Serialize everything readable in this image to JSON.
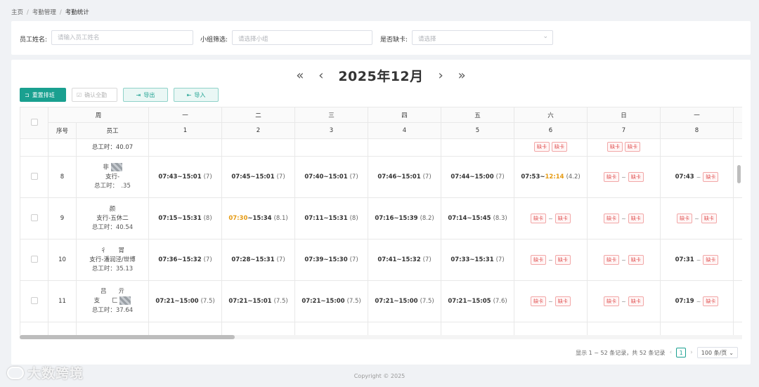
{
  "breadcrumb": [
    "主页",
    "考勤管理",
    "考勤统计"
  ],
  "filters": {
    "name_label": "员工姓名:",
    "name_placeholder": "请输入员工姓名",
    "group_label": "小组筛选:",
    "group_placeholder": "请选择小组",
    "missing_label": "是否缺卡:",
    "missing_placeholder": "请选择"
  },
  "month_nav": {
    "prev_year": "«",
    "prev_month": "‹",
    "title": "2025年12月",
    "next_month": "›",
    "next_year": "»"
  },
  "toolbar": {
    "reset_label": "重置排班",
    "confirm_label": "确认全勤",
    "export_label": "导出",
    "import_label": "导入"
  },
  "table": {
    "header_week_label": "周",
    "header_index_label": "序号",
    "header_employee_label": "员工",
    "weekdays": [
      "一",
      "二",
      "三",
      "四",
      "五",
      "六",
      "日",
      "一"
    ],
    "dates": [
      "1",
      "2",
      "3",
      "4",
      "5",
      "6",
      "7",
      "8"
    ],
    "partial_row_hours": "总工时：40.07",
    "rows": [
      {
        "index": "8",
        "name": "非",
        "team": "支行-",
        "hours": "总工时：　.35",
        "d1": {
          "in": "07:43",
          "out": "15:01",
          "hrs": "(7)"
        },
        "d2": {
          "in": "07:45",
          "out": "15:01",
          "hrs": "(7)"
        },
        "d3": {
          "in": "07:40",
          "out": "15:01",
          "hrs": "(7)"
        },
        "d4": {
          "in": "07:46",
          "out": "15:01",
          "hrs": "(7)"
        },
        "d5": {
          "in": "07:44",
          "out": "15:00",
          "hrs": "(7)"
        },
        "d6": {
          "in": "07:53",
          "out": "12:14",
          "hrs": "(4.2)"
        },
        "d8_in": "07:43"
      },
      {
        "index": "9",
        "name": "颜",
        "team": "支行-五休二",
        "hours": "总工时：40.54",
        "d1": {
          "in": "07:15",
          "out": "15:31",
          "hrs": "(8)"
        },
        "d2": {
          "in": "07:30",
          "out": "15:34",
          "hrs": "(8.1)"
        },
        "d3": {
          "in": "07:11",
          "out": "15:31",
          "hrs": "(8)"
        },
        "d4": {
          "in": "07:16",
          "out": "15:39",
          "hrs": "(8.2)"
        },
        "d5": {
          "in": "07:14",
          "out": "15:45",
          "hrs": "(8.3)"
        }
      },
      {
        "index": "10",
        "name": "彳　　冐",
        "team": "支行-潘润泾/世博",
        "hours": "总工时：35.13",
        "d1": {
          "in": "07:36",
          "out": "15:32",
          "hrs": "(7)"
        },
        "d2": {
          "in": "07:28",
          "out": "15:31",
          "hrs": "(7)"
        },
        "d3": {
          "in": "07:39",
          "out": "15:30",
          "hrs": "(7)"
        },
        "d4": {
          "in": "07:41",
          "out": "15:32",
          "hrs": "(7)"
        },
        "d5": {
          "in": "07:33",
          "out": "15:31",
          "hrs": "(7)"
        },
        "d8_in": "07:31"
      },
      {
        "index": "11",
        "name": "吕　　亓",
        "team": "支　　匚",
        "hours": "总工时：37.64",
        "d1": {
          "in": "07:21",
          "out": "15:00",
          "hrs": "(7.5)"
        },
        "d2": {
          "in": "07:21",
          "out": "15:01",
          "hrs": "(7.5)"
        },
        "d3": {
          "in": "07:21",
          "out": "15:00",
          "hrs": "(7.5)"
        },
        "d4": {
          "in": "07:21",
          "out": "15:00",
          "hrs": "(7.5)"
        },
        "d5": {
          "in": "07:21",
          "out": "15:05",
          "hrs": "(7.6)"
        },
        "d8_in": "07:19"
      }
    ],
    "missing_badge": "缺卡",
    "tilde": "~"
  },
  "pagination": {
    "summary": "显示 1 ~ 52 条记录，共 52 条记录",
    "prev": "‹",
    "current_page": "1",
    "next": "›",
    "page_size": "100 条/页"
  },
  "footer": {
    "copyright": "Copyright © 2025"
  },
  "watermark": {
    "text": "大数跨境"
  },
  "colors": {
    "primary": "#1aa090",
    "late": "#e59a12",
    "missing": "#e05252"
  }
}
